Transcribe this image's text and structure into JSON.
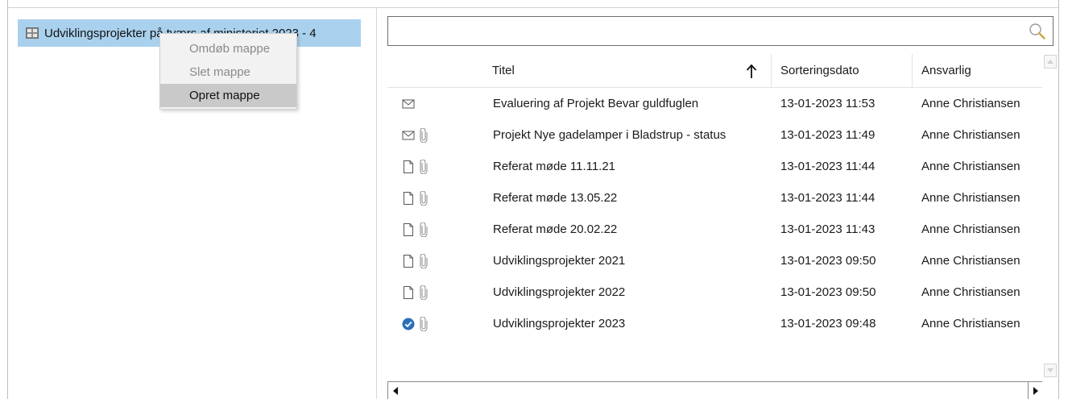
{
  "tree": {
    "root_label": "Udviklingsprojekter på tværs af ministeriet 2023 - 4",
    "root_icon": "folder-grid-icon"
  },
  "context_menu": {
    "items": [
      {
        "label": "Omdøb mappe",
        "enabled": false
      },
      {
        "label": "Slet mappe",
        "enabled": false
      },
      {
        "label": "Opret mappe",
        "enabled": true
      }
    ]
  },
  "search": {
    "value": "",
    "placeholder": "",
    "icon": "search-icon"
  },
  "grid": {
    "columns": {
      "title": "Titel",
      "sort_date": "Sorteringsdato",
      "responsible": "Ansvarlig"
    },
    "sort": {
      "column": "Titel",
      "direction": "ascending",
      "icon": "arrow-up-icon"
    },
    "rows": [
      {
        "icon": "envelope-icon",
        "attachment": false,
        "title": "Evaluering af Projekt Bevar guldfuglen",
        "date": "13-01-2023 11:53",
        "responsible": "Anne Christiansen"
      },
      {
        "icon": "envelope-icon",
        "attachment": true,
        "title": "Projekt Nye gadelamper i Bladstrup - status",
        "date": "13-01-2023 11:49",
        "responsible": "Anne Christiansen"
      },
      {
        "icon": "document-icon",
        "attachment": true,
        "title": "Referat møde 11.11.21",
        "date": "13-01-2023 11:44",
        "responsible": "Anne Christiansen"
      },
      {
        "icon": "document-icon",
        "attachment": true,
        "title": "Referat møde 13.05.22",
        "date": "13-01-2023 11:44",
        "responsible": "Anne Christiansen"
      },
      {
        "icon": "document-icon",
        "attachment": true,
        "title": "Referat møde 20.02.22",
        "date": "13-01-2023 11:43",
        "responsible": "Anne Christiansen"
      },
      {
        "icon": "document-icon",
        "attachment": true,
        "title": "Udviklingsprojekter 2021",
        "date": "13-01-2023 09:50",
        "responsible": "Anne Christiansen"
      },
      {
        "icon": "document-icon",
        "attachment": true,
        "title": "Udviklingsprojekter 2022",
        "date": "13-01-2023 09:50",
        "responsible": "Anne Christiansen"
      },
      {
        "icon": "check-circle-icon",
        "attachment": true,
        "title": "Udviklingsprojekter 2023",
        "date": "13-01-2023 09:48",
        "responsible": "Anne Christiansen"
      }
    ]
  },
  "colors": {
    "tree_selection": "#a9d1ee",
    "menu_highlight": "#c9c9c9",
    "check_blue": "#2b6fb8"
  }
}
